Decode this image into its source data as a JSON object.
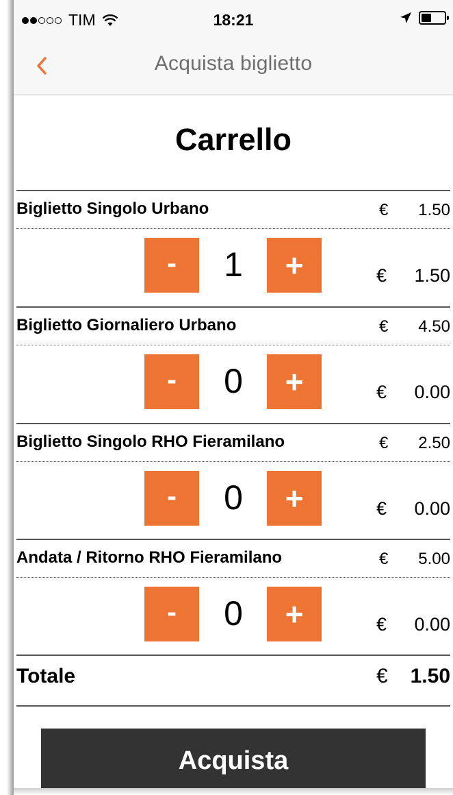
{
  "colors": {
    "accent": "#ee7433",
    "buy_button": "#333333",
    "nav_title": "#6e6e6e"
  },
  "status_bar": {
    "carrier": "TIM",
    "time": "18:21",
    "signal_bars_filled": 2,
    "signal_bars_total": 5,
    "battery_level": 0.45,
    "icons": [
      "wifi-icon",
      "location-arrow-icon",
      "battery-icon"
    ]
  },
  "nav": {
    "back_icon": "chevron-left-icon",
    "title": "Acquista biglietto"
  },
  "page": {
    "title": "Carrello"
  },
  "currency": "€",
  "items": [
    {
      "name": "Biglietto Singolo Urbano",
      "unit_price": "1.50",
      "minus_label": "-",
      "plus_label": "+",
      "quantity": "1",
      "subtotal": "1.50"
    },
    {
      "name": "Biglietto Giornaliero Urbano",
      "unit_price": "4.50",
      "minus_label": "-",
      "plus_label": "+",
      "quantity": "0",
      "subtotal": "0.00"
    },
    {
      "name": "Biglietto Singolo RHO Fieramilano",
      "unit_price": "2.50",
      "minus_label": "-",
      "plus_label": "+",
      "quantity": "0",
      "subtotal": "0.00"
    },
    {
      "name": "Andata / Ritorno RHO Fieramilano",
      "unit_price": "5.00",
      "minus_label": "-",
      "plus_label": "+",
      "quantity": "0",
      "subtotal": "0.00"
    }
  ],
  "total": {
    "label": "Totale",
    "value": "1.50"
  },
  "buy_button": {
    "label": "Acquista"
  }
}
